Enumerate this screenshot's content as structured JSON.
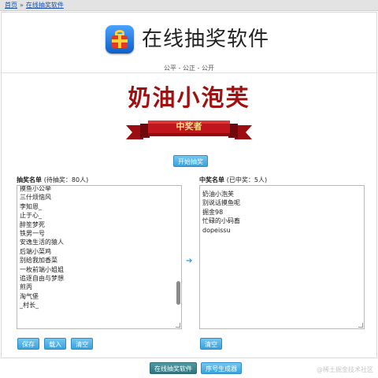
{
  "breadcrumb": {
    "home": "首页",
    "current": "在线抽奖软件"
  },
  "header": {
    "title": "在线抽奖软件",
    "motto": "公平 - 公正 - 公开"
  },
  "winner": {
    "name": "奶油小泡芙",
    "banner_label": "中奖者",
    "start_button": "开始抽奖"
  },
  "left_panel": {
    "title": "抽奖名单",
    "subtitle": "(待抽奖：80人)",
    "items": [
      "摸鱼小公举",
      "三什烦恼风",
      "李知恩_",
      "止于心_",
      "醉笙梦死",
      "铁男一号",
      "安逸生活的猿人",
      "后端小菜鸡",
      "别给我加香菜",
      "一枚前端小姐姐",
      "追逐自由与梦想",
      "煎丙",
      "淘气堡",
      "_村长_"
    ],
    "buttons": {
      "save": "保存",
      "load": "载入",
      "clear": "清空"
    },
    "scroll_position": 0.85
  },
  "arrow_symbol": "➔",
  "right_panel": {
    "title": "中奖名单",
    "subtitle": "(已中奖：5人)",
    "items": [
      "奶油小泡芙",
      "别说话摸鱼呢",
      "掘金98",
      "忙碌的小码畜",
      "dopeissu"
    ],
    "buttons": {
      "clear": "清空"
    }
  },
  "footer": {
    "online_button": "在线抽奖软件",
    "number_button": "序号生成器"
  },
  "watermark": "@稀土掘金技术社区",
  "colors": {
    "accent": "#39a2dd",
    "winner_red": "#a01010",
    "ribbon_red": "#c0151a",
    "link_blue": "#1a4fa6"
  }
}
